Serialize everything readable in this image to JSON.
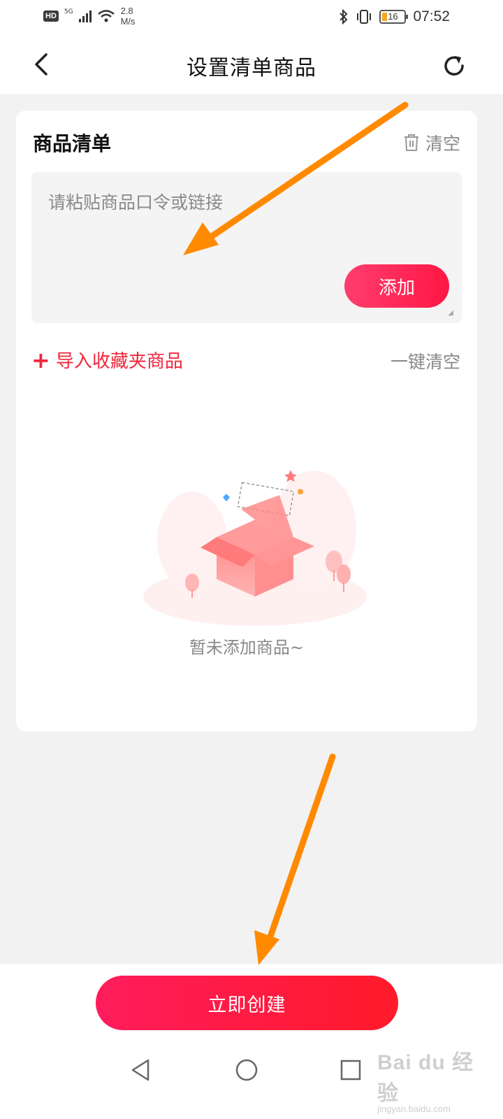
{
  "status_bar": {
    "hd": "HD",
    "network": "5G",
    "speed_value": "2.8",
    "speed_unit": "M/s",
    "battery": "16",
    "time": "07:52"
  },
  "header": {
    "title": "设置清单商品",
    "back_icon": "chevron-left-icon",
    "refresh_icon": "refresh-icon"
  },
  "card": {
    "title": "商品清单",
    "clear_label": "清空",
    "input": {
      "placeholder": "请粘贴商品口令或链接",
      "value": ""
    },
    "add_label": "添加",
    "import_plus": "+",
    "import_label": "导入收藏夹商品",
    "clear_all_label": "一键清空",
    "empty_text": "暂未添加商品~"
  },
  "bottom": {
    "create_label": "立即创建"
  },
  "nav": {
    "back_icon": "triangle-back-icon",
    "home_icon": "circle-home-icon",
    "recents_icon": "square-recents-icon"
  },
  "watermark": {
    "main": "Bai du 经验",
    "sub": "jingyan.baidu.com"
  },
  "colors": {
    "accent": "#ff1744",
    "import_red": "#f0263c",
    "annotation_arrow": "#ff8a00"
  }
}
